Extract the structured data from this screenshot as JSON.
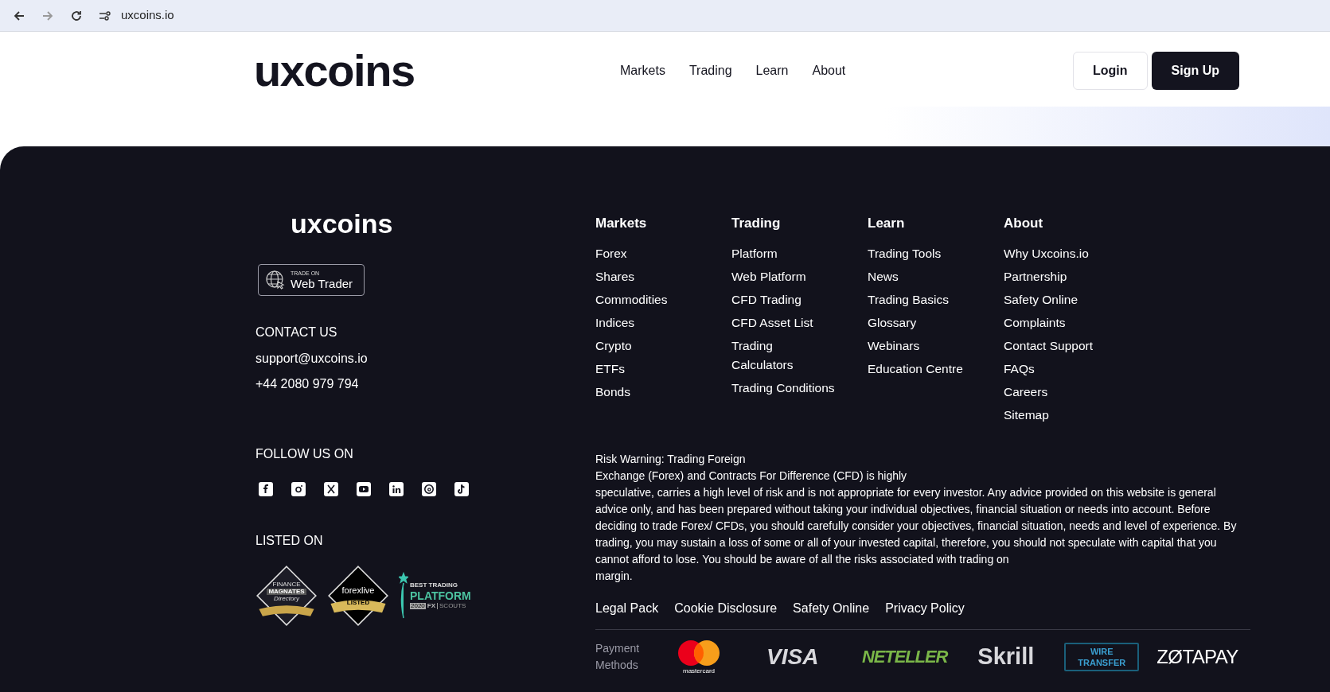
{
  "browser": {
    "url": "uxcoins.io"
  },
  "header": {
    "logo": "uxcoins",
    "nav": [
      "Markets",
      "Trading",
      "Learn",
      "About"
    ],
    "buttons": [
      {
        "label": "Login",
        "kind": "outline"
      },
      {
        "label": "Sign Up",
        "kind": "solid"
      }
    ]
  },
  "footer": {
    "logo": "uxcoins",
    "web_trader": {
      "small": "TRADE ON",
      "label": "Web Trader"
    },
    "contact": {
      "title": "CONTACT US",
      "lines": [
        "support@uxcoins.io",
        "+44 2080 979 794"
      ]
    },
    "follow": {
      "title": "FOLLOW US ON"
    },
    "listed": {
      "title": "LISTED ON",
      "badges": [
        {
          "kind": "magnates",
          "texts": [
            "FINANCE",
            "MAGNATES",
            "Directory"
          ]
        },
        {
          "kind": "forexlive",
          "texts": [
            "forexlive",
            "LISTED"
          ]
        },
        {
          "kind": "fxscouts",
          "texts": [
            "BEST TRADING",
            "PLATFORM",
            "2020",
            "FX",
            "SCOUTS"
          ]
        }
      ]
    },
    "columns": [
      {
        "title": "Markets",
        "items": [
          "Forex",
          "Shares",
          "Commodities",
          "Indices",
          "Crypto",
          "ETFs",
          "Bonds"
        ]
      },
      {
        "title": "Trading",
        "items": [
          "Platform",
          "Web Platform",
          "CFD Trading",
          "CFD Asset List",
          "Trading\nCalculators",
          "Trading Conditions"
        ]
      },
      {
        "title": "Learn",
        "items": [
          "Trading Tools",
          "News",
          "Trading Basics",
          "Glossary",
          "Webinars",
          "Education Centre"
        ]
      },
      {
        "title": "About",
        "items": [
          "Why Uxcoins.io",
          "Partnership",
          "Safety Online",
          "Complaints",
          "Contact Support",
          "FAQs",
          "Careers",
          "Sitemap"
        ]
      }
    ],
    "risk_warning": "Risk Warning: Trading Foreign\nExchange (Forex) and Contracts For Difference (CFD) is highly\nspeculative, carries a high level of risk and is not appropriate for every investor. Any advice provided on this website is general advice only, and has been prepared without taking your individual objectives, financial situation or needs into account. Before deciding to trade Forex/ CFDs, you should carefully consider your objectives, financial situation, needs and level of experience. By trading, you may sustain a loss of some or all of your invested capital, therefore, you should not speculate with capital that you cannot afford to lose. You should be aware of all the risks associated with trading on\nmargin.",
    "legal_links": [
      "Legal Pack",
      "Cookie Disclosure",
      "Safety Online",
      "Privacy Policy"
    ],
    "payment": {
      "label": "Payment\nMethods",
      "methods": [
        {
          "kind": "mastercard",
          "text": "mastercard"
        },
        {
          "kind": "visa",
          "text": "VISA"
        },
        {
          "kind": "neteller",
          "text": "NETELLER"
        },
        {
          "kind": "skrill",
          "text": "Skrill"
        },
        {
          "kind": "wire",
          "text": "WIRE\nTRANSFER"
        },
        {
          "kind": "zotapay",
          "text": "ZØTAPAY"
        }
      ]
    }
  }
}
